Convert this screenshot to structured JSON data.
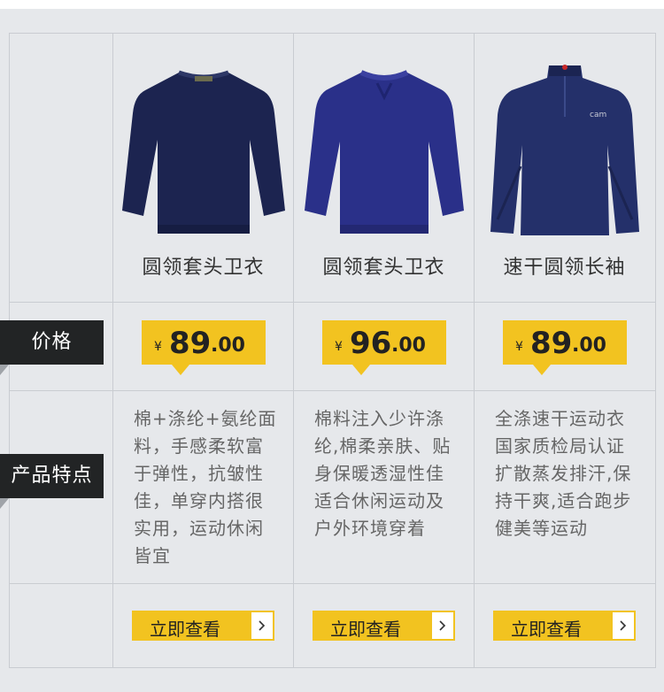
{
  "row_labels": {
    "price": "价格",
    "features": "产品特点"
  },
  "currency_symbol": "¥",
  "button_label": "立即查看",
  "colors": {
    "accent": "#f2c320",
    "label_bg": "#222425"
  },
  "products": [
    {
      "name": "圆领套头卫衣",
      "price_int": "89",
      "price_dec": ".00",
      "features": [
        "棉+涤纶+氨纶面",
        "料，手感柔软富",
        "于弹性，抗皱性",
        "佳，单穿内搭很",
        "实用，运动休闲",
        "皆宜"
      ],
      "image": "navy-crewneck-sweatshirt"
    },
    {
      "name": "圆领套头卫衣",
      "price_int": "96",
      "price_dec": ".00",
      "features": [
        "棉料注入少许涤",
        "纶,棉柔亲肤、贴",
        "身保暖透湿性佳",
        "适合休闲运动及",
        "户外环境穿着"
      ],
      "image": "blue-crewneck-sweatshirt"
    },
    {
      "name": "速干圆领长袖",
      "price_int": "89",
      "price_dec": ".00",
      "features": [
        "全涤速干运动衣",
        "国家质检局认证",
        "扩散蒸发排汗,保",
        "持干爽,适合跑步",
        "健美等运动"
      ],
      "image": "navy-zip-neck-long-sleeve"
    }
  ]
}
